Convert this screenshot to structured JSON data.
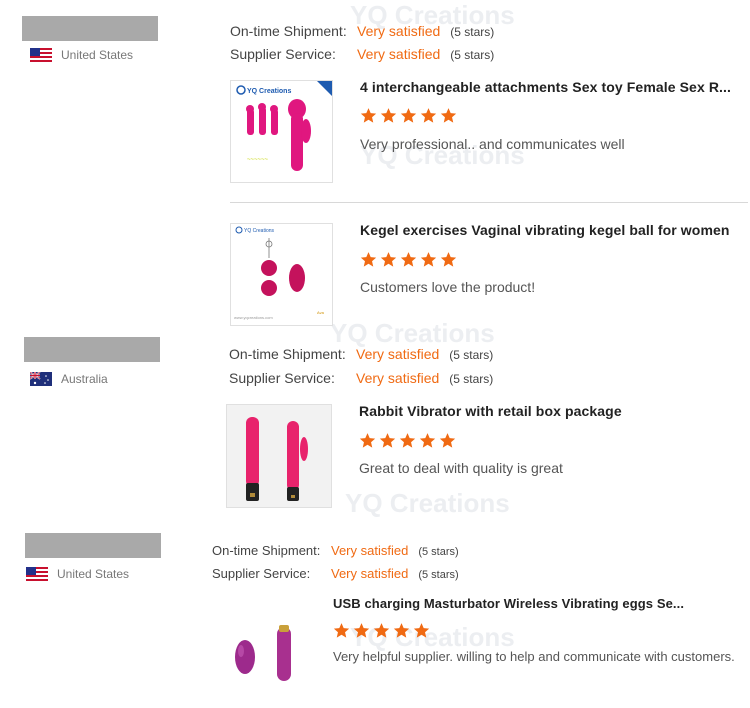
{
  "labels": {
    "ontime": "On-time Shipment:",
    "supplier": "Supplier Service:"
  },
  "watermark": "YQ Creations",
  "reviews": [
    {
      "country": "United States",
      "ontime_value": "Very satisfied",
      "ontime_stars": "(5 stars)",
      "supplier_value": "Very satisfied",
      "supplier_stars": "(5 stars)",
      "products": [
        {
          "title": "4 interchangeable attachments Sex toy Female Sex R...",
          "rating": 5,
          "comment": "Very professional.. and communicates well",
          "thumb_brand": "YQ Creations"
        },
        {
          "title": "Kegel exercises Vaginal vibrating kegel ball for women",
          "rating": 5,
          "comment": "Customers love the product!",
          "thumb_brand": "YQ Creations"
        }
      ]
    },
    {
      "country": "Australia",
      "ontime_value": "Very satisfied",
      "ontime_stars": "(5 stars)",
      "supplier_value": "Very satisfied",
      "supplier_stars": "(5 stars)",
      "products": [
        {
          "title": "Rabbit Vibrator with retail box package",
          "rating": 5,
          "comment": "Great to deal with quality is great"
        }
      ]
    },
    {
      "country": "United States",
      "ontime_value": "Very satisfied",
      "ontime_stars": "(5 stars)",
      "supplier_value": "Very satisfied",
      "supplier_stars": "(5 stars)",
      "products": [
        {
          "title": "USB charging Masturbator Wireless Vibrating eggs Se...",
          "rating": 5,
          "comment": "Very helpful supplier. willing to help and communicate with customers."
        }
      ]
    }
  ],
  "colors": {
    "accent": "#f06a13",
    "name_bar": "#a9a9a9",
    "product_pink": "#e0177f"
  }
}
